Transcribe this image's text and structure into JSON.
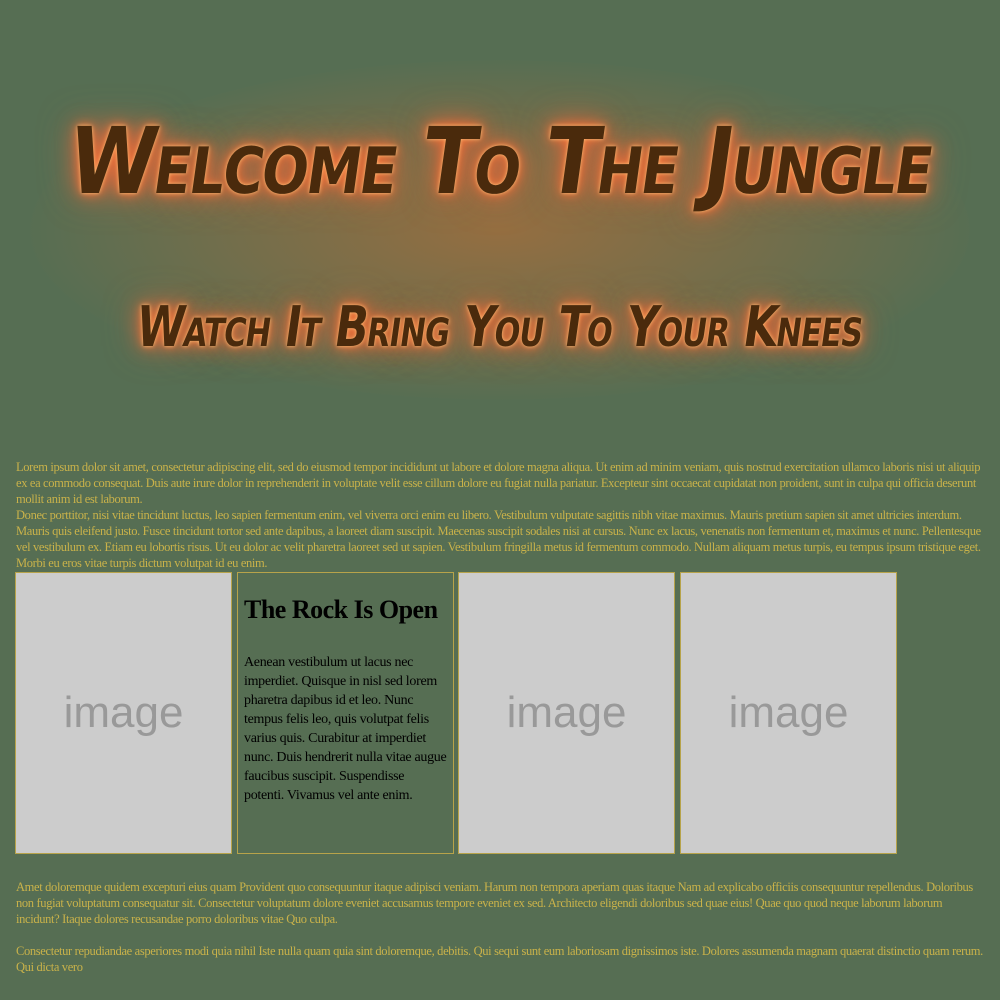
{
  "hero": {
    "title": "Welcome To The Jungle",
    "subtitle": "Watch It Bring You To Your Knees"
  },
  "paragraphs": [
    "Lorem ipsum dolor sit amet, consectetur adipiscing elit, sed do eiusmod tempor incididunt ut labore et dolore magna aliqua. Ut enim ad minim veniam, quis nostrud exercitation ullamco laboris nisi ut aliquip ex ea commodo consequat. Duis aute irure dolor in reprehenderit in voluptate velit esse cillum dolore eu fugiat nulla pariatur. Excepteur sint occaecat cupidatat non proident, sunt in culpa qui officia deserunt mollit anim id est laborum.",
    "Donec porttitor, nisi vitae tincidunt luctus, leo sapien fermentum enim, vel viverra orci enim eu libero. Vestibulum vulputate sagittis nibh vitae maximus. Mauris pretium sapien sit amet ultricies interdum. Mauris quis eleifend justo. Fusce tincidunt tortor sed ante dapibus, a laoreet diam suscipit. Maecenas suscipit sodales nisi at cursus. Nunc ex lacus, venenatis non fermentum et, maximus et nunc. Pellentesque vel vestibulum ex. Etiam eu lobortis risus. Ut eu dolor ac velit pharetra laoreet sed ut sapien. Vestibulum fringilla metus id fermentum commodo. Nullam aliquam metus turpis, eu tempus ipsum tristique eget. Morbi eu eros vitae turpis dictum volutpat id eu enim.",
    "Amet doloremque quidem excepturi eius quam Provident quo consequuntur itaque adipisci veniam. Harum non tempora aperiam quas itaque Nam ad explicabo officiis consequuntur repellendus. Doloribus non fugiat voluptatum consequatur sit. Consectetur voluptatum dolore eveniet accusamus tempore eveniet ex sed. Architecto eligendi doloribus sed quae eius! Quae quo quod neque laborum laborum incidunt? Itaque dolores recusandae porro doloribus vitae Quo culpa.",
    "Consectetur repudiandae asperiores modi quia nihil Iste nulla quam quia sint doloremque, debitis. Qui sequi sunt eum laboriosam dignissimos iste. Dolores assumenda magnam quaerat distinctio quam rerum. Qui dicta vero"
  ],
  "cards": [
    {
      "placeholder": "image"
    },
    {
      "title": "The Rock Is Open",
      "body": "Aenean vestibulum ut lacus nec imperdiet. Quisque in nisl sed lorem pharetra dapibus id et leo. Nunc tempus felis leo, quis volutpat felis varius quis. Curabitur at imperdiet nunc. Duis hendrerit nulla vitae augue faucibus suscipit. Suspendisse potenti. Vivamus vel ante enim."
    },
    {
      "placeholder": "image"
    },
    {
      "placeholder": "image"
    }
  ]
}
